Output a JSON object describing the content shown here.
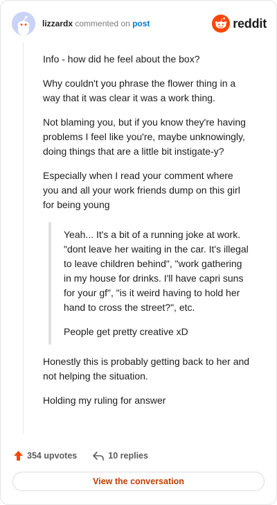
{
  "comment": {
    "username": "lizzardx",
    "action_text": "commented on",
    "post_link_text": "post",
    "paragraphs": [
      "Info - how did he feel about the box?",
      "Why couldn't you phrase the flower thing in a way that it was clear it was a work thing.",
      "Not blaming you, but if you know they're having problems I feel like you're, maybe unknowingly, doing things that are a little bit instigate-y?",
      "Especially when I read your comment where you and all your work friends dump on this girl for being young"
    ],
    "quote": [
      "Yeah... It's a bit of a running joke at work. \"dont leave her waiting in the car. It's illegal to leave children behind\", \"work gathering in my house for drinks. I'll have capri suns for your gf\", \"is it weird having to hold her hand to cross the street?\", etc.",
      "People get pretty creative xD"
    ],
    "after_quote": [
      "Honestly this is probably getting back to her and not helping the situation.",
      "Holding my ruling for answer"
    ]
  },
  "logo": {
    "wordmark": "reddit",
    "icon": "reddit-alien-icon",
    "color": "#ff4500"
  },
  "stats": {
    "upvotes": "354 upvotes",
    "replies": "10 replies",
    "upvote_icon": "upvote-arrow-icon",
    "reply_icon": "reply-arrow-icon",
    "upvote_color": "#ff4500"
  },
  "cta": {
    "label": "View the conversation",
    "color": "#c33d00"
  }
}
